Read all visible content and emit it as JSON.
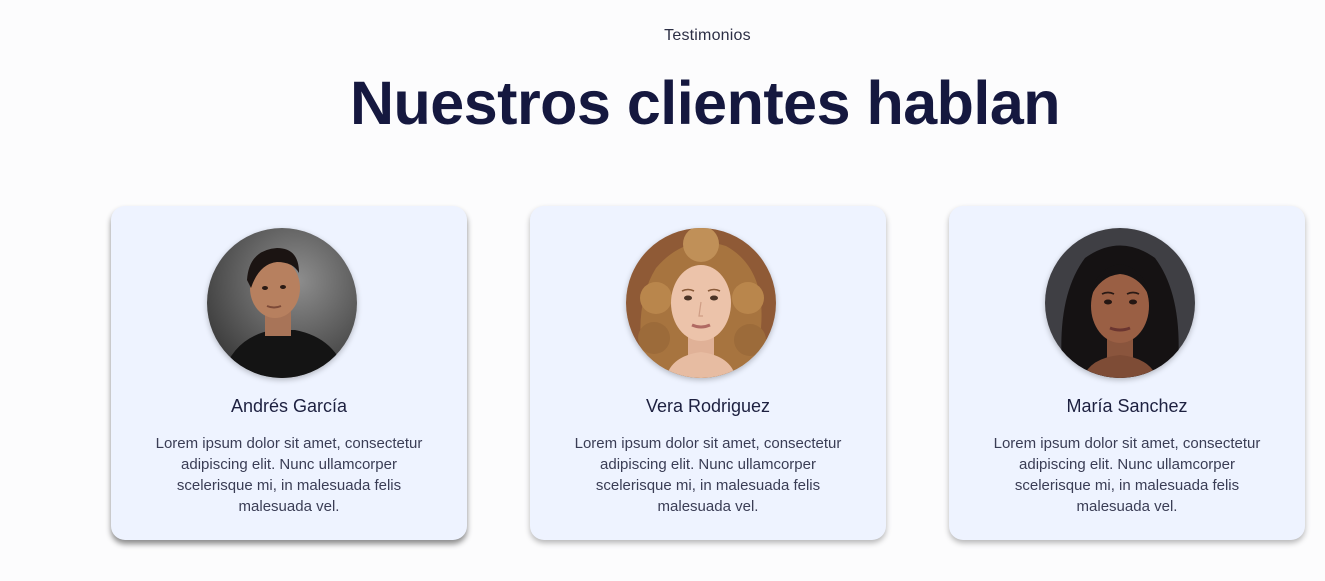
{
  "section": {
    "eyebrow": "Testimonios",
    "title": "Nuestros clientes hablan"
  },
  "testimonials": [
    {
      "name": "Andrés García",
      "text": "Lorem ipsum dolor sit amet, consectetur adipiscing elit. Nunc ullamcorper scelerisque mi, in malesuada felis malesuada vel.",
      "avatar": "man-portrait-photo"
    },
    {
      "name": "Vera Rodriguez",
      "text": "Lorem ipsum dolor sit amet, consectetur adipiscing elit. Nunc ullamcorper scelerisque mi, in malesuada felis malesuada vel.",
      "avatar": "woman-curly-hair-portrait-photo"
    },
    {
      "name": "María Sanchez",
      "text": "Lorem ipsum dolor sit amet, consectetur adipiscing elit. Nunc ullamcorper scelerisque mi, in malesuada felis malesuada vel.",
      "avatar": "woman-dark-hair-portrait-photo"
    }
  ],
  "colors": {
    "background": "#fcfcfd",
    "card": "#eef3ff",
    "title": "#15183f"
  }
}
